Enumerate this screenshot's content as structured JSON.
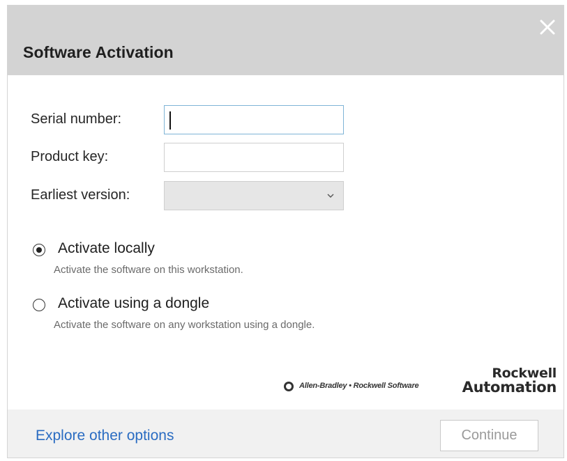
{
  "dialog": {
    "title": "Software Activation"
  },
  "form": {
    "serial_label": "Serial number:",
    "serial_value": "",
    "product_key_label": "Product key:",
    "product_key_value": "",
    "earliest_version_label": "Earliest version:",
    "earliest_version_value": ""
  },
  "activation_options": [
    {
      "label": "Activate locally",
      "description": "Activate the software on this workstation.",
      "selected": true
    },
    {
      "label": "Activate using a dongle",
      "description": "Activate the software on any workstation using a dongle.",
      "selected": false
    }
  ],
  "branding": {
    "tagline": "Allen-Bradley  •  Rockwell Software",
    "logo_line1": "Rockwell",
    "logo_line2": "Automation"
  },
  "footer": {
    "explore_label": "Explore other options",
    "continue_label": "Continue"
  },
  "colors": {
    "titlebar": "#d3d3d3",
    "link": "#2a6cc2",
    "focus_border": "#7fb4d6",
    "footer": "#f1f1f1"
  }
}
